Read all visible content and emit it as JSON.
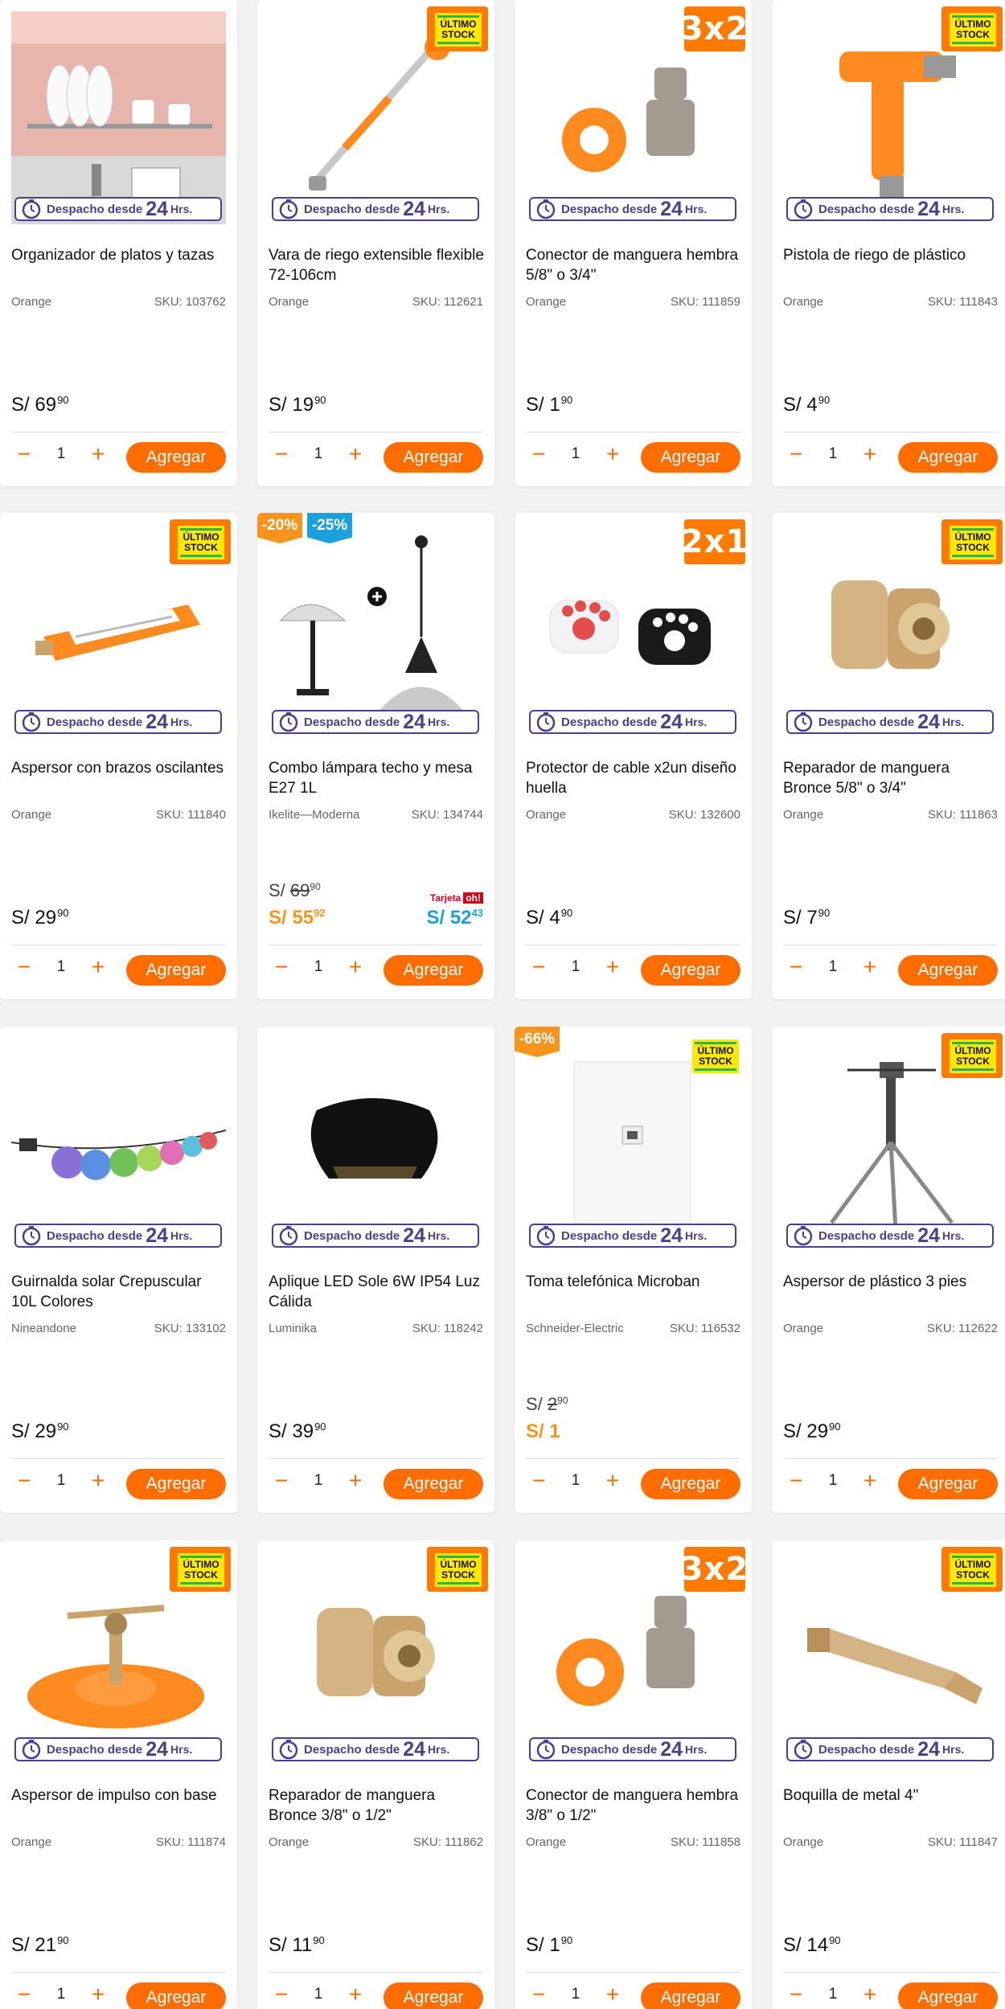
{
  "despacho": {
    "label": "Despacho desde",
    "hours": "24",
    "suffix": "Hrs."
  },
  "add_label": "Agregar",
  "currency": "S/",
  "stock_badge": "ÚLTIMO STOCK",
  "colors": {
    "accent": "#ff6d00",
    "despacho": "#4a3f8c",
    "oh_price": "#1aa0dc",
    "sale_price": "#f7941d"
  },
  "products": [
    {
      "title": "Organizador de platos y tazas",
      "brand": "Orange",
      "sku": "SKU: 103762",
      "price_int": "69",
      "price_dec": "90",
      "qty": "1"
    },
    {
      "title": "Vara de riego extensible flexible 72-106cm",
      "brand": "Orange",
      "sku": "SKU: 112621",
      "price_int": "19",
      "price_dec": "90",
      "qty": "1"
    },
    {
      "title": "Conector de manguera hembra 5/8\" o 3/4\"",
      "brand": "Orange",
      "sku": "SKU: 111859",
      "price_int": "1",
      "price_dec": "90",
      "qty": "1",
      "promo": "3x2"
    },
    {
      "title": "Pistola de riego de plástico",
      "brand": "Orange",
      "sku": "SKU: 111843",
      "price_int": "4",
      "price_dec": "90",
      "qty": "1"
    },
    {
      "title": "Aspersor con brazos oscilantes",
      "brand": "Orange",
      "sku": "SKU: 111840",
      "price_int": "29",
      "price_dec": "90",
      "qty": "1"
    },
    {
      "title": "Combo lámpara techo y mesa E27 1L",
      "brand": "Ikelite—Moderna",
      "sku": "SKU: 134744",
      "old_int": "69",
      "old_dec": "90",
      "price_int": "55",
      "price_dec": "92",
      "oh_int": "52",
      "oh_dec": "43",
      "tarjeta": "Tarjeta",
      "oh_label": "oh!",
      "disc1": "-20%",
      "disc2": "-25%",
      "qty": "1"
    },
    {
      "title": "Protector de cable x2un diseño huella",
      "brand": "Orange",
      "sku": "SKU: 132600",
      "price_int": "4",
      "price_dec": "90",
      "qty": "1",
      "promo": "2x1"
    },
    {
      "title": "Reparador de manguera Bronce 5/8\" o 3/4\"",
      "brand": "Orange",
      "sku": "SKU: 111863",
      "price_int": "7",
      "price_dec": "90",
      "qty": "1"
    },
    {
      "title": "Guirnalda solar Crepuscular 10L Colores",
      "brand": "Nineandone",
      "sku": "SKU: 133102",
      "price_int": "29",
      "price_dec": "90",
      "qty": "1"
    },
    {
      "title": "Aplique LED Sole 6W IP54 Luz Cálida",
      "brand": "Luminika",
      "sku": "SKU: 118242",
      "price_int": "39",
      "price_dec": "90",
      "qty": "1"
    },
    {
      "title": "Toma telefónica Microban",
      "brand": "Schneider-Electric",
      "sku": "SKU: 116532",
      "old_int": "2",
      "old_dec": "90",
      "price_int": "1",
      "disc1": "-66%",
      "qty": "1"
    },
    {
      "title": "Aspersor de plástico 3 pies",
      "brand": "Orange",
      "sku": "SKU: 112622",
      "price_int": "29",
      "price_dec": "90",
      "qty": "1"
    },
    {
      "title": "Aspersor de impulso con base",
      "brand": "Orange",
      "sku": "SKU: 111874",
      "price_int": "21",
      "price_dec": "90",
      "qty": "1"
    },
    {
      "title": "Reparador de manguera Bronce 3/8\" o 1/2\"",
      "brand": "Orange",
      "sku": "SKU: 111862",
      "price_int": "11",
      "price_dec": "90",
      "qty": "1"
    },
    {
      "title": "Conector de manguera hembra 3/8\" o 1/2\"",
      "brand": "Orange",
      "sku": "SKU: 111858",
      "price_int": "1",
      "price_dec": "90",
      "qty": "1",
      "promo": "3x2"
    },
    {
      "title": "Boquilla de metal 4\"",
      "brand": "Orange",
      "sku": "SKU: 111847",
      "price_int": "14",
      "price_dec": "90",
      "qty": "1"
    }
  ]
}
